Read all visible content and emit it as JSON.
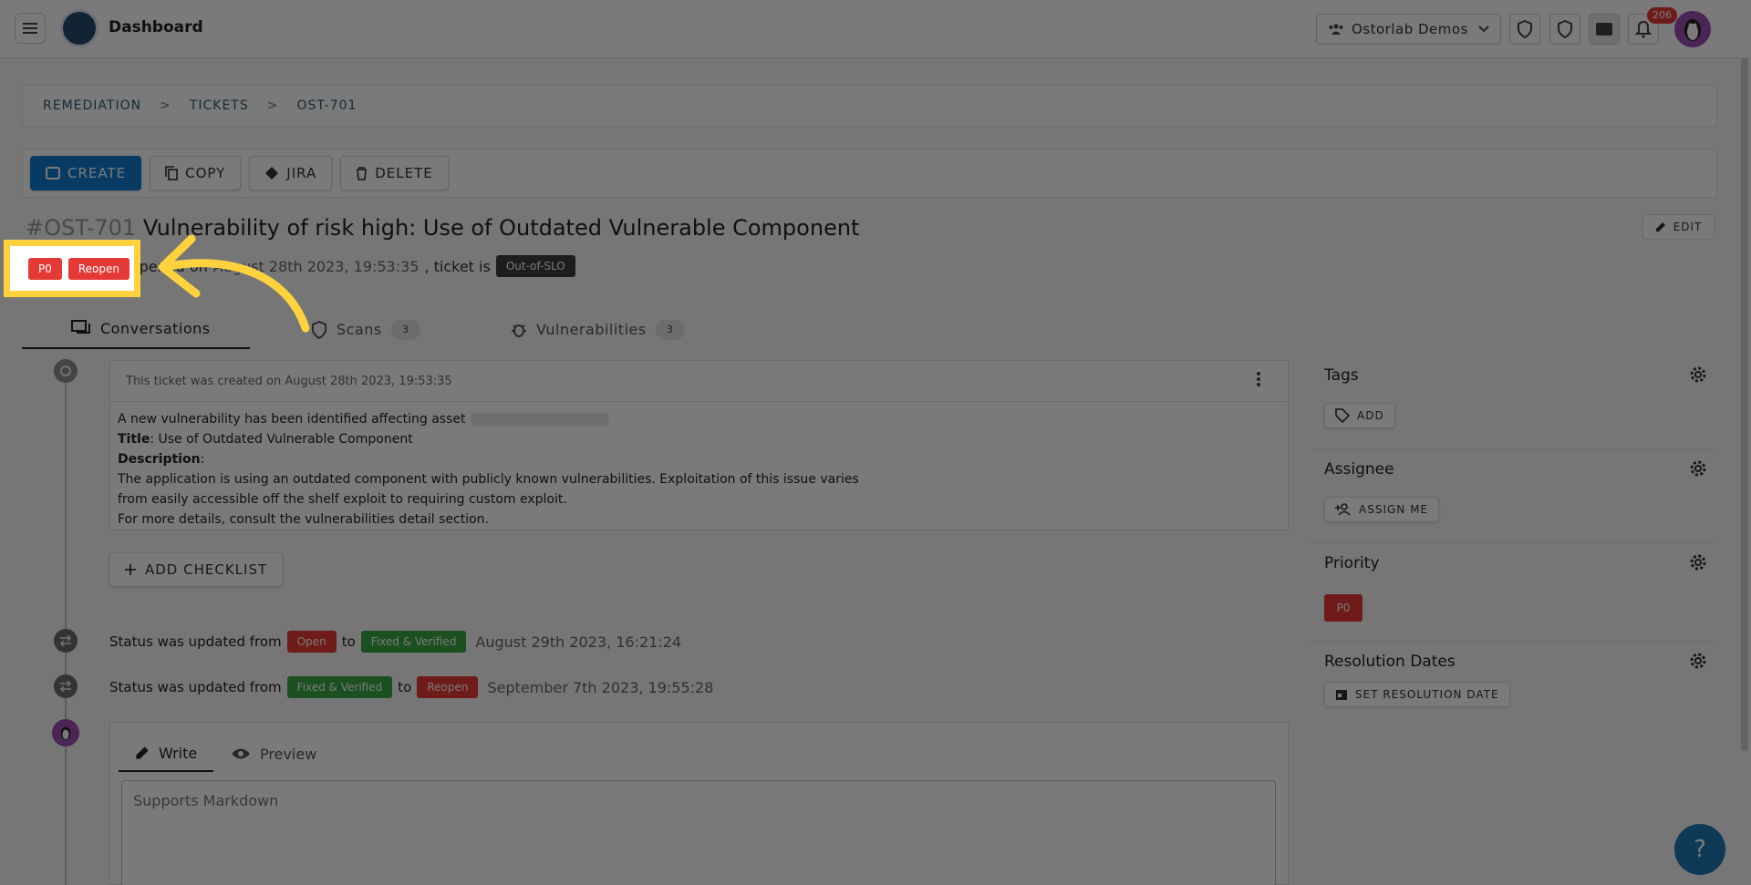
{
  "header": {
    "app_title": "Dashboard",
    "org_name": "Ostorlab Demos",
    "notification_count": "206"
  },
  "breadcrumb": [
    "REMEDIATION",
    "TICKETS",
    "OST-701"
  ],
  "breadcrumb_separator": ">",
  "actions": {
    "create": "CREATE",
    "copy": "COPY",
    "jira": "JIRA",
    "delete": "DELETE"
  },
  "ticket": {
    "id": "#OST-701",
    "title": "Vulnerability of risk high: Use of Outdated Vulnerable Component",
    "edit_label": "EDIT",
    "priority": "P0",
    "status": "Reopen",
    "opened_text": "Opened on",
    "opened_date": "August 28th 2023, 19:53:35",
    "slo_prefix": ", ticket is",
    "slo_status": "Out-of-SLO"
  },
  "tabs": [
    {
      "label": "Conversations"
    },
    {
      "label": "Scans",
      "count": "3"
    },
    {
      "label": "Vulnerabilities",
      "count": "3"
    }
  ],
  "comment": {
    "header": "This ticket was created on August 28th 2023, 19:53:35",
    "intro": "A new vulnerability has been identified affecting asset",
    "title_label": "Title",
    "title_value": ": Use of Outdated Vulnerable Component",
    "description_label": "Description",
    "description_suffix": ":",
    "line1": "The application is using an outdated component with publicly known vulnerabilities. Exploitation of this issue varies",
    "line2": "from easily accessible off the shelf exploit to requiring custom exploit.",
    "line3": "For more details, consult the vulnerabilities detail section."
  },
  "add_checklist": "ADD CHECKLIST",
  "events": [
    {
      "prefix": "Status was updated from",
      "from": "Open",
      "to_word": "to",
      "to": "Fixed & Verified",
      "date": "August 29th 2023, 16:21:24"
    },
    {
      "prefix": "Status was updated from",
      "from": "Fixed & Verified",
      "to_word": "to",
      "to": "Reopen",
      "date": "September 7th 2023, 19:55:28"
    }
  ],
  "editor": {
    "write": "Write",
    "preview": "Preview",
    "placeholder": "Supports Markdown"
  },
  "sidebar": {
    "tags": {
      "title": "Tags",
      "button": "ADD"
    },
    "assignee": {
      "title": "Assignee",
      "button": "ASSIGN ME"
    },
    "priority": {
      "title": "Priority",
      "value": "P0"
    },
    "resolution": {
      "title": "Resolution Dates",
      "button": "SET RESOLUTION DATE"
    }
  },
  "help_label": "?",
  "colors": {
    "primary": "#117bd0",
    "danger": "#e53935",
    "success": "#3aa845",
    "highlight": "#ffd23e",
    "help": "#1e7ab8"
  }
}
